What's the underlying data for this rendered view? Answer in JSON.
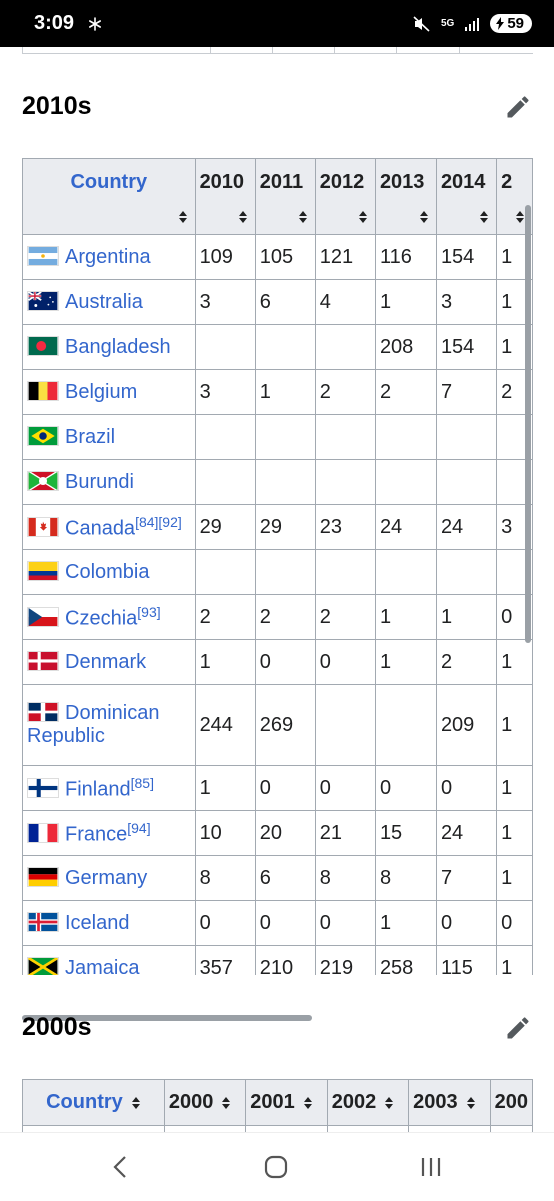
{
  "status": {
    "time": "3:09",
    "battery": "59",
    "network": "5G"
  },
  "sections": [
    {
      "heading": "2010s",
      "columns": [
        "Country",
        "2010",
        "2011",
        "2012",
        "2013",
        "2014",
        "2"
      ],
      "rows": [
        {
          "country": "Argentina",
          "refs": "",
          "flag": "argentina",
          "values": [
            "109",
            "105",
            "121",
            "116",
            "154",
            "1"
          ]
        },
        {
          "country": "Australia",
          "refs": "",
          "flag": "australia",
          "values": [
            "3",
            "6",
            "4",
            "1",
            "3",
            "1"
          ]
        },
        {
          "country": "Bangladesh",
          "refs": "",
          "flag": "bangladesh",
          "values": [
            "",
            "",
            "",
            "208",
            "154",
            "1"
          ]
        },
        {
          "country": "Belgium",
          "refs": "",
          "flag": "belgium",
          "values": [
            "3",
            "1",
            "2",
            "2",
            "7",
            "2"
          ]
        },
        {
          "country": "Brazil",
          "refs": "",
          "flag": "brazil",
          "values": [
            "",
            "",
            "",
            "",
            "",
            ""
          ]
        },
        {
          "country": "Burundi",
          "refs": "",
          "flag": "burundi",
          "values": [
            "",
            "",
            "",
            "",
            "",
            ""
          ]
        },
        {
          "country": "Canada",
          "refs": "[84][92]",
          "flag": "canada",
          "values": [
            "29",
            "29",
            "23",
            "24",
            "24",
            "3"
          ]
        },
        {
          "country": "Colombia",
          "refs": "",
          "flag": "colombia",
          "values": [
            "",
            "",
            "",
            "",
            "",
            ""
          ]
        },
        {
          "country": "Czechia",
          "refs": "[93]",
          "flag": "czechia",
          "values": [
            "2",
            "2",
            "2",
            "1",
            "1",
            "0"
          ]
        },
        {
          "country": "Denmark",
          "refs": "",
          "flag": "denmark",
          "values": [
            "1",
            "0",
            "0",
            "1",
            "2",
            "1"
          ]
        },
        {
          "country": "Dominican Republic",
          "refs": "",
          "flag": "dominican",
          "values": [
            "244",
            "269",
            "",
            "",
            "209",
            "1"
          ]
        },
        {
          "country": "Finland",
          "refs": "[85]",
          "flag": "finland",
          "values": [
            "1",
            "0",
            "0",
            "0",
            "0",
            "1"
          ]
        },
        {
          "country": "France",
          "refs": "[94]",
          "flag": "france",
          "values": [
            "10",
            "20",
            "21",
            "15",
            "24",
            "1"
          ]
        },
        {
          "country": "Germany",
          "refs": "",
          "flag": "germany",
          "values": [
            "8",
            "6",
            "8",
            "8",
            "7",
            "1"
          ]
        },
        {
          "country": "Iceland",
          "refs": "",
          "flag": "iceland",
          "values": [
            "0",
            "0",
            "0",
            "1",
            "0",
            "0"
          ]
        },
        {
          "country": "Jamaica",
          "refs": "",
          "flag": "jamaica",
          "values": [
            "357",
            "210",
            "219",
            "258",
            "115",
            "1"
          ]
        }
      ]
    },
    {
      "heading": "2000s",
      "columns": [
        "Country",
        "2000",
        "2001",
        "2002",
        "2003",
        "200"
      ]
    }
  ],
  "nav": {
    "back": "back-icon",
    "home": "home-icon",
    "recents": "recents-icon"
  }
}
